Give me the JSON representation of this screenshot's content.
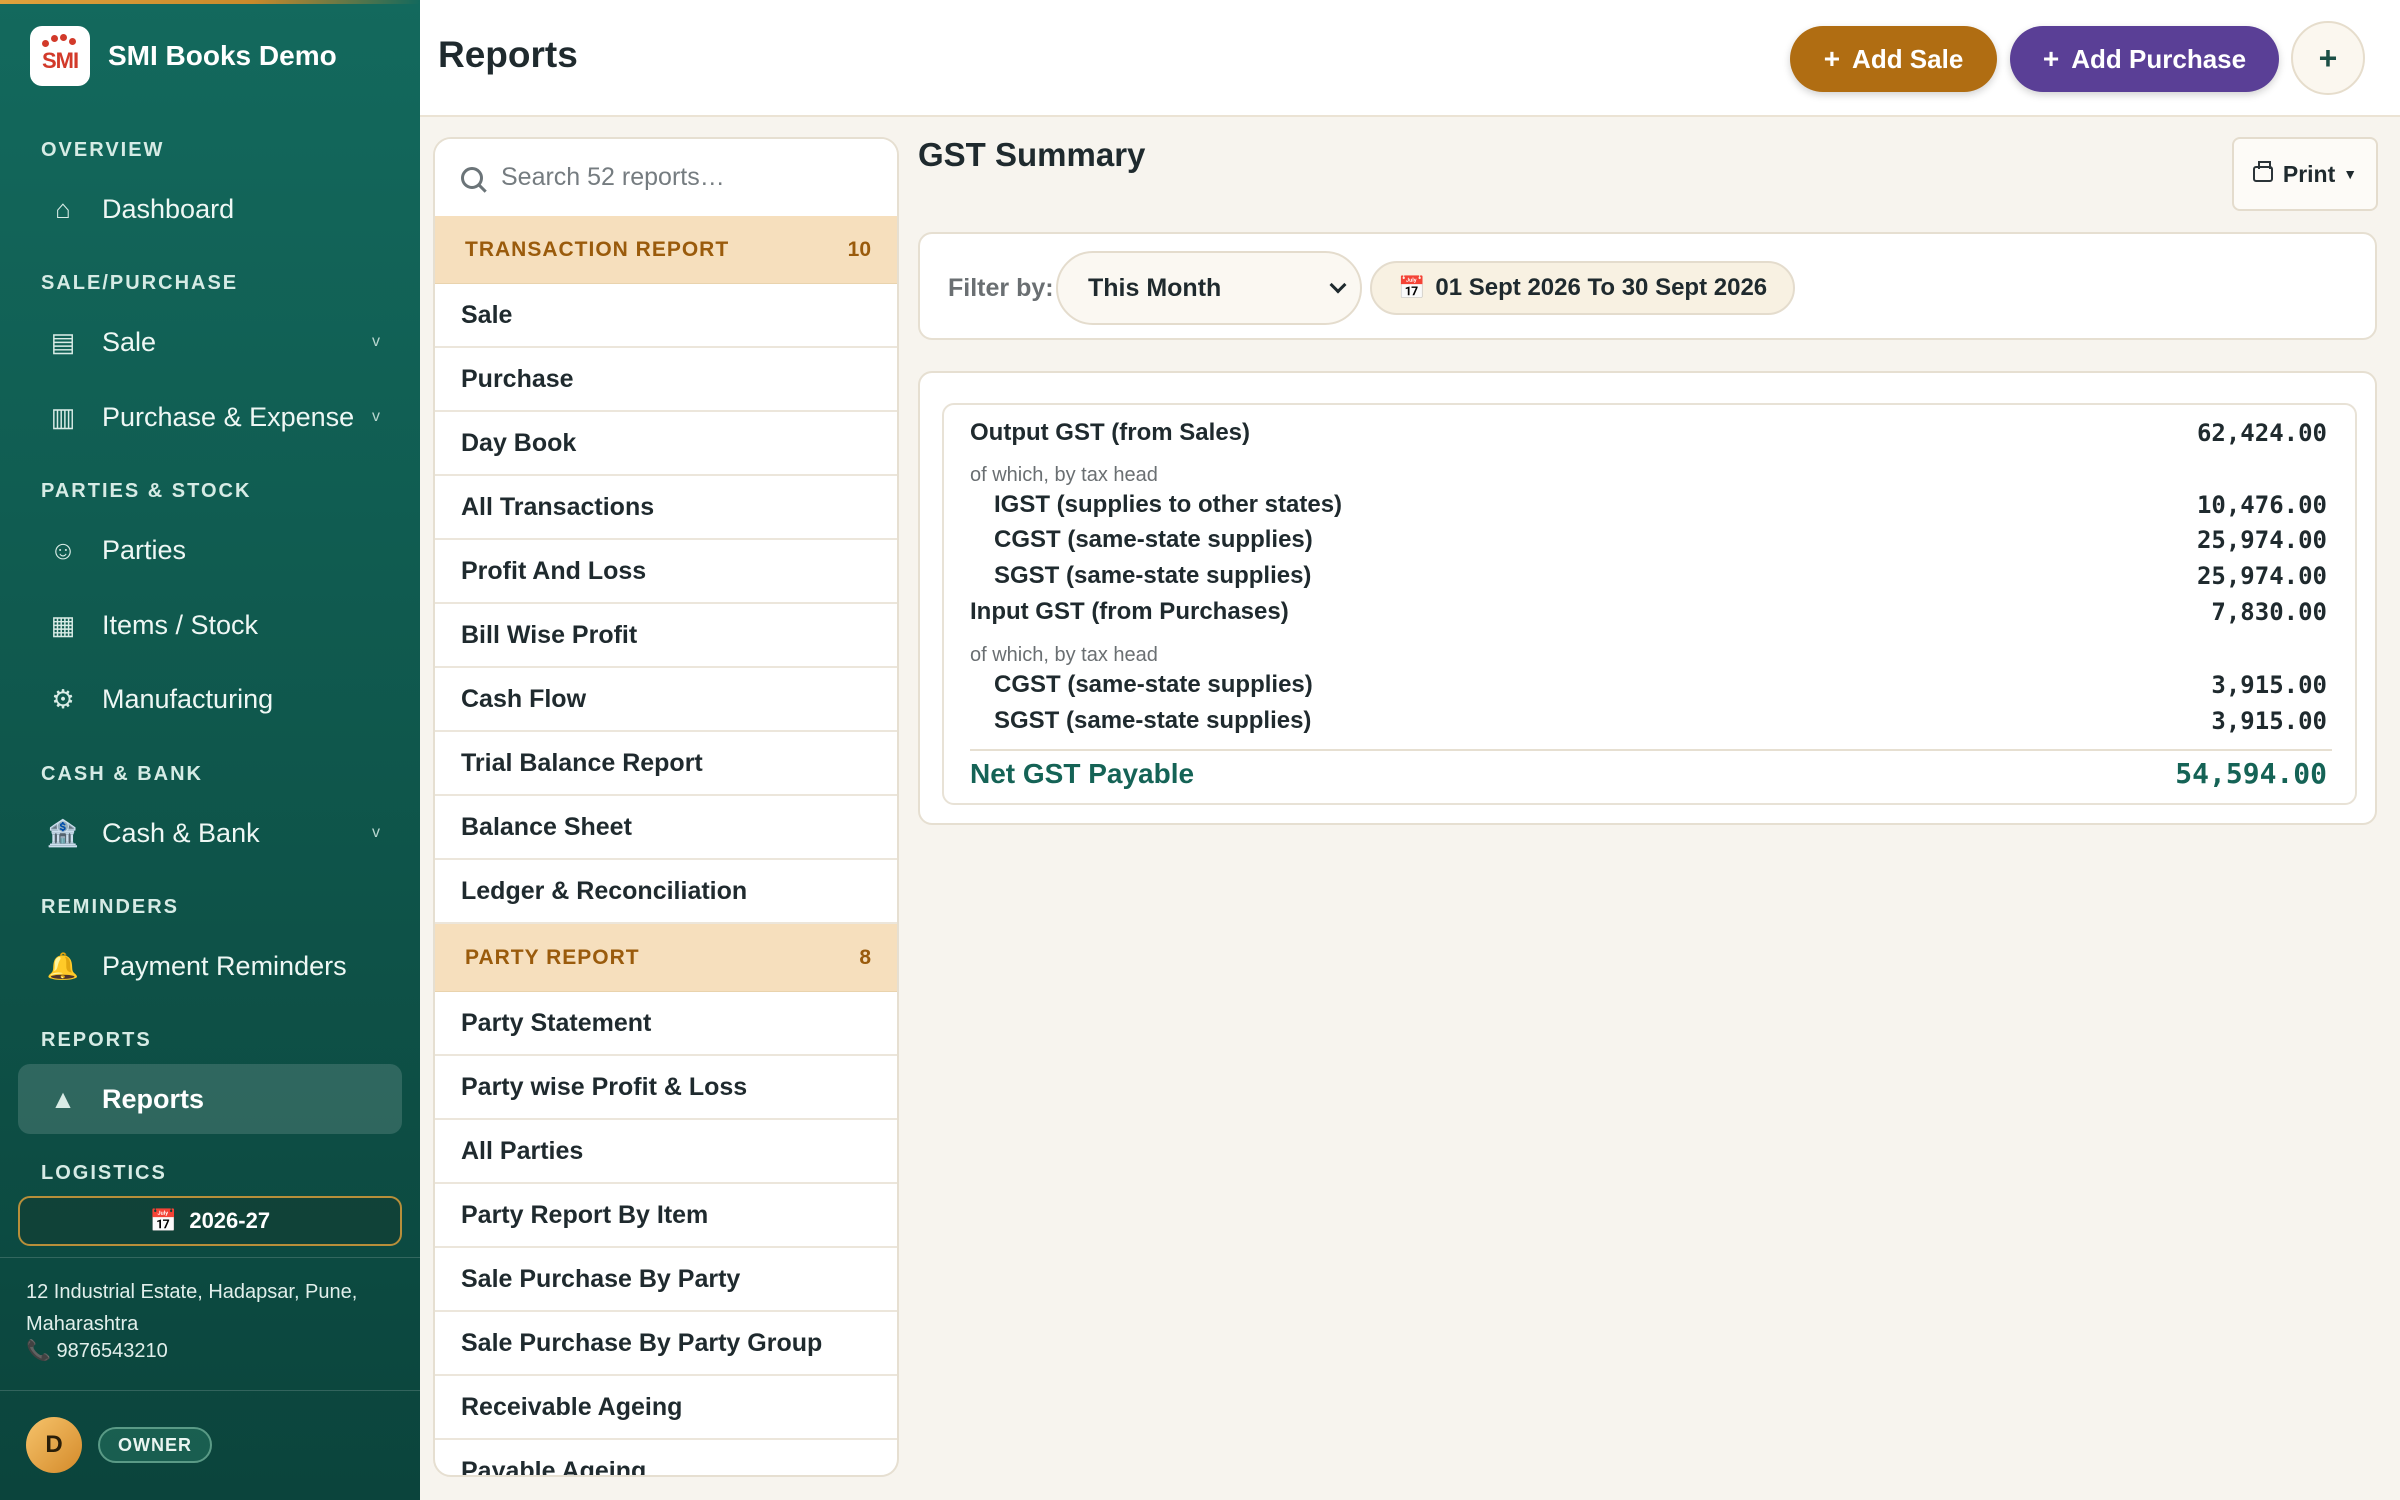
{
  "brand": {
    "name": "SMI Books Demo",
    "logo_text": "SMI"
  },
  "sidebar": {
    "sections": {
      "overview": "OVERVIEW",
      "sale_purchase": "SALE/PURCHASE",
      "parties_stock": "PARTIES & STOCK",
      "cash_bank": "CASH & BANK",
      "reminders": "REMINDERS",
      "reports": "REPORTS",
      "logistics": "LOGISTICS"
    },
    "items": [
      {
        "label": "Dashboard",
        "icon": "home-icon"
      },
      {
        "label": "Sale",
        "icon": "receipt-icon",
        "expandable": true
      },
      {
        "label": "Purchase & Expense",
        "icon": "bill-icon",
        "expandable": true
      },
      {
        "label": "Parties",
        "icon": "smiley-icon"
      },
      {
        "label": "Items / Stock",
        "icon": "grid-icon"
      },
      {
        "label": "Manufacturing",
        "icon": "gear-icon"
      },
      {
        "label": "Cash & Bank",
        "icon": "bank-icon",
        "expandable": true
      },
      {
        "label": "Payment Reminders",
        "icon": "bell-icon"
      },
      {
        "label": "Reports",
        "icon": "triangle-icon",
        "active": true
      }
    ],
    "financial_year": "2026-27",
    "address": "12 Industrial Estate, Hadapsar, Pune, Maharashtra",
    "phone": "9876543210",
    "user_initial": "D",
    "user_role": "OWNER"
  },
  "header": {
    "title": "Reports",
    "add_sale": "Add Sale",
    "add_purchase": "Add Purchase",
    "more": "+"
  },
  "reports_list": {
    "search_placeholder": "Search 52 reports…",
    "groups": [
      {
        "label": "TRANSACTION REPORT",
        "count": "10",
        "items": [
          "Sale",
          "Purchase",
          "Day Book",
          "All Transactions",
          "Profit And Loss",
          "Bill Wise Profit",
          "Cash Flow",
          "Trial Balance Report",
          "Balance Sheet",
          "Ledger & Reconciliation"
        ]
      },
      {
        "label": "PARTY REPORT",
        "count": "8",
        "items": [
          "Party Statement",
          "Party wise Profit & Loss",
          "All Parties",
          "Party Report By Item",
          "Sale Purchase By Party",
          "Sale Purchase By Party Group",
          "Receivable Ageing",
          "Payable Ageing"
        ]
      }
    ]
  },
  "content": {
    "title": "GST Summary",
    "print_label": "Print",
    "filter_label": "Filter by:",
    "period_selected": "This Month",
    "date_range": "01 Sept 2026 To 30 Sept 2026",
    "summary": {
      "output_label": "Output GST (from Sales)",
      "output_value": "62,424.00",
      "output_note": "of which, by tax head",
      "output_lines": [
        {
          "label": "IGST (supplies to other states)",
          "value": "10,476.00"
        },
        {
          "label": "CGST (same-state supplies)",
          "value": "25,974.00"
        },
        {
          "label": "SGST (same-state supplies)",
          "value": "25,974.00"
        }
      ],
      "input_label": "Input GST (from Purchases)",
      "input_value": "7,830.00",
      "input_note": "of which, by tax head",
      "input_lines": [
        {
          "label": "CGST (same-state supplies)",
          "value": "3,915.00"
        },
        {
          "label": "SGST (same-state supplies)",
          "value": "3,915.00"
        }
      ],
      "net_label": "Net GST Payable",
      "net_value": "54,594.00"
    }
  },
  "colors": {
    "sidebar": "#13695d",
    "accent_orange": "#b06d12",
    "accent_purple": "#5a3f96",
    "group_header": "#f6dfbd",
    "net_total": "#156356"
  }
}
